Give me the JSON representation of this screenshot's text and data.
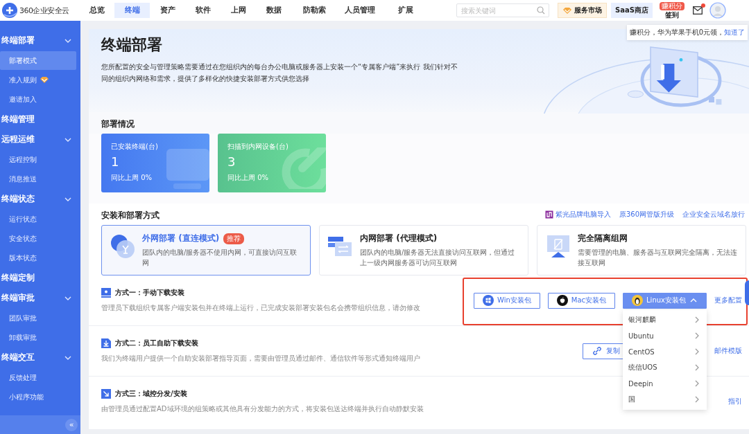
{
  "top_nav": {
    "logo": "360企业安全云",
    "tabs": [
      {
        "label": "总览",
        "selected": false
      },
      {
        "label": "终端",
        "selected": true
      },
      {
        "label": "资产",
        "selected": false
      },
      {
        "label": "软件",
        "selected": false
      },
      {
        "label": "上网",
        "selected": false
      },
      {
        "label": "数据",
        "selected": false
      },
      {
        "label": "防勒索",
        "selected": false
      },
      {
        "label": "人员管理",
        "selected": false
      },
      {
        "label": "扩展",
        "selected": false
      }
    ],
    "search": {
      "placeholder": "搜索关键词"
    },
    "service_market": "服务市场",
    "saas_store": "SaaS商店",
    "sign_in": {
      "label": "签到",
      "badge": "赚积分"
    },
    "mail": {
      "unread": true
    }
  },
  "tooltip": {
    "text": "赚积分，华为苹果手机0元领，",
    "link": "知道了"
  },
  "sidebar": {
    "groups": [
      {
        "label": "终端部署",
        "expanded": true,
        "children": [
          {
            "label": "部署模式",
            "selected": true,
            "premium": false
          },
          {
            "label": "准入规则",
            "selected": false,
            "premium": true
          },
          {
            "label": "邀请加入",
            "selected": false,
            "premium": false
          }
        ]
      },
      {
        "label": "终端管理"
      },
      {
        "label": "远程运维",
        "expanded": true,
        "children": [
          {
            "label": "远程控制",
            "selected": false,
            "premium": false
          },
          {
            "label": "消息推送",
            "selected": false,
            "premium": false
          }
        ]
      },
      {
        "label": "终端状态",
        "expanded": true,
        "children": [
          {
            "label": "运行状态",
            "selected": false,
            "premium": false
          },
          {
            "label": "安全状态",
            "selected": false,
            "premium": false
          },
          {
            "label": "版本状态",
            "selected": false,
            "premium": false
          }
        ]
      },
      {
        "label": "终端定制"
      },
      {
        "label": "终端审批",
        "expanded": true,
        "children": [
          {
            "label": "团队审批",
            "selected": false,
            "premium": false
          },
          {
            "label": "卸载审批",
            "selected": false,
            "premium": false
          }
        ]
      },
      {
        "label": "终端交互",
        "expanded": true,
        "children": [
          {
            "label": "反馈处理",
            "selected": false,
            "premium": false
          },
          {
            "label": "小程序功能",
            "selected": false,
            "premium": false
          }
        ]
      }
    ],
    "collapse": "«"
  },
  "page": {
    "title": "终端部署",
    "description": "您所配置的安全与管理策略需要通过在您组织内的每台办公电脑或服务器上安装一个“专属客户端”来执行 我们针对不同的组织内网络和需求，提供了多样化的快捷安装部署方式供您选择"
  },
  "deployment_status": {
    "heading": "部署情况",
    "cards": [
      {
        "kind": "installed",
        "label": "已安装终端(台)",
        "value": "1",
        "compare": "同比上周 0%"
      },
      {
        "kind": "scanned",
        "label": "扫描到内网设备(台)",
        "value": "3",
        "compare": "同比上周 0%"
      }
    ]
  },
  "install_methods": {
    "heading": "安装和部署方式",
    "links": [
      {
        "label": "紫光品牌电脑导入",
        "kind": "brand"
      },
      {
        "label": "原360网管版升级",
        "kind": "plain"
      },
      {
        "label": "企业安全云域名放行",
        "kind": "plain"
      }
    ],
    "modes": [
      {
        "kind": "external",
        "title": "外网部署 (直连模式)",
        "badge": "推荐",
        "description": "团队内的电脑/服务器不使用内网，可直接访问互联网",
        "selected": true
      },
      {
        "kind": "internal",
        "title": "内网部署 (代理模式)",
        "description": "团队内的电脑/服务器无法直接访问互联网，但通过上一级内网服务器可访问互联网",
        "selected": false
      },
      {
        "kind": "isolated",
        "title": "完全隔离组网",
        "description": "需要管理的电脑、服务器与互联网完全隔离，无法连接互联网",
        "selected": false
      }
    ]
  },
  "methods": [
    {
      "kind": "manual",
      "title": "方式一：手动下载安装",
      "description": "管理员下载组织专属客户端安装包并在终端上运行，已完成安装部署安装包名会携带组织信息，请勿修改",
      "highlighted": true,
      "buttons": [
        {
          "kind": "windows",
          "label": "Win安装包"
        },
        {
          "kind": "mac",
          "label": "Mac安装包"
        },
        {
          "kind": "linux",
          "label": "Linux安装包",
          "expanded": true
        }
      ],
      "link": "更多配置"
    },
    {
      "kind": "self",
      "title": "方式二：员工自助下载安装",
      "description": "我们为终端用户提供一个自助安装部署指导页面，需要由管理员通过邮件、通信软件等形式通知终端用户",
      "buttons": [
        {
          "kind": "copy",
          "label": "复制"
        }
      ],
      "link": "邮件模版"
    },
    {
      "kind": "domain",
      "title": "方式三：域控分发/安装",
      "description": "由管理员通过配置AD域环境的组策略或其他具有分发能力的方式，将安装包送达终端并执行自动静默安装",
      "link": "指引"
    }
  ],
  "linux_menu": [
    {
      "label": "银河麒麟"
    },
    {
      "label": "Ubuntu"
    },
    {
      "label": "CentOS"
    },
    {
      "label": "统信UOS"
    },
    {
      "label": "Deepin"
    },
    {
      "label": "国"
    }
  ]
}
